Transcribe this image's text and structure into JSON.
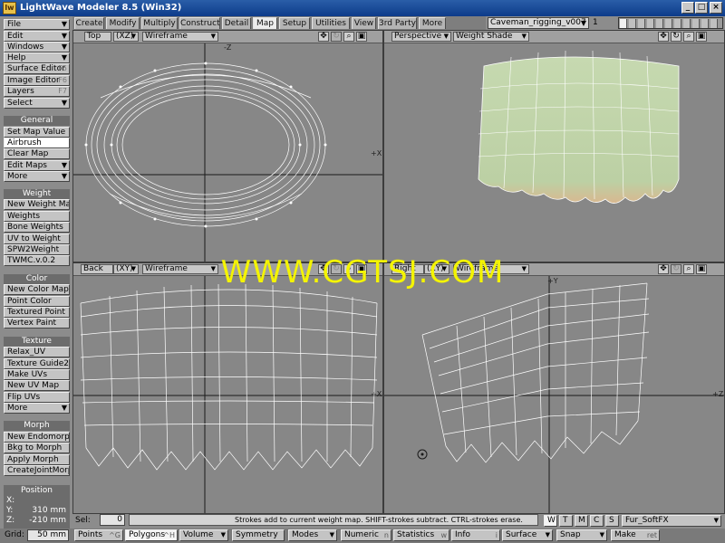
{
  "window": {
    "title": "LightWave Modeler 8.5 (Win32)",
    "app_icon": "lw",
    "min_label": "_",
    "max_label": "□",
    "close_label": "×"
  },
  "tabs": [
    "Create",
    "Modify",
    "Multiply",
    "Construct",
    "Detail",
    "Map",
    "Setup",
    "Utilities",
    "View",
    "3rd Party",
    "More"
  ],
  "active_tab": "Map",
  "scene": {
    "name": "Caveman_rigging_v007",
    "layer": "1"
  },
  "menu": {
    "file": "File",
    "edit": "Edit",
    "windows": "Windows",
    "help": "Help",
    "surface_editor": "Surface Editor",
    "surface_editor_key": "F5",
    "image_editor": "Image Editor",
    "image_editor_key": "F6",
    "layers": "Layers",
    "layers_key": "F7",
    "select": "Select"
  },
  "groups": {
    "general": {
      "title": "General",
      "items": [
        "Set Map Value",
        "Airbrush",
        "Clear Map",
        "Edit Maps",
        "More"
      ]
    },
    "weight": {
      "title": "Weight",
      "items": [
        "New Weight Map",
        "Weights",
        "Bone Weights",
        "UV to Weight",
        "SPW2Weight",
        "TWMC.v.0.2"
      ]
    },
    "color": {
      "title": "Color",
      "items": [
        "New Color Map",
        "Point Color",
        "Textured Point",
        "Vertex Paint"
      ]
    },
    "texture": {
      "title": "Texture",
      "items": [
        "Relax_UV",
        "Texture Guide2",
        "Make UVs",
        "New UV Map",
        "Flip UVs",
        "More"
      ]
    },
    "morph": {
      "title": "Morph",
      "items": [
        "New Endomorph",
        "Bkg to Morph",
        "Apply Morph",
        "CreateJointMorph"
      ]
    }
  },
  "position": {
    "title": "Position",
    "x_label": "X:",
    "x": "",
    "y_label": "Y:",
    "y": "310 mm",
    "z_label": "Z:",
    "z": "-210 mm"
  },
  "viewports": {
    "top": {
      "view": "Top",
      "axis": "(XZ)",
      "mode": "Wireframe"
    },
    "perspective": {
      "view": "Perspective",
      "mode": "Weight Shade"
    },
    "back": {
      "view": "Back",
      "axis": "(XY)",
      "mode": "Wireframe"
    },
    "right": {
      "view": "Right",
      "axis": "(ZY)",
      "mode": "Wireframe"
    }
  },
  "axis_labels": {
    "z": "-Z",
    "x": "+X",
    "y": "+Y",
    "xr": "+X",
    "zr": "+Z"
  },
  "watermark": "WWW.CGTSJ.COM",
  "status": {
    "sel_label": "Sel:",
    "sel_value": "0",
    "message": "Strokes add to current weight map. SHIFT-strokes subtract. CTRL-strokes erase.",
    "map_letters": [
      "W",
      "T",
      "M",
      "C",
      "S"
    ],
    "active_map_letter": "W",
    "map_name": "Fur_SoftFX"
  },
  "bottom": {
    "grid_label": "Grid:",
    "grid_value": "50 mm",
    "points": "Points",
    "points_key": "^G",
    "polygons": "Polygons",
    "polygons_key": "^H",
    "volume": "Volume",
    "symmetry": "Symmetry",
    "modes": "Modes",
    "numeric": "Numeric",
    "numeric_key": "n",
    "statistics": "Statistics",
    "statistics_key": "w",
    "info": "Info",
    "info_key": "i",
    "surface": "Surface",
    "snap": "Snap",
    "make": "Make",
    "make_key": "ret"
  },
  "colors": {
    "title_bar": "#0d3b8a",
    "viewport_bg": "#878787",
    "wire": "#ffffff",
    "mesh_shade": "#c4d6b0",
    "watermark": "#f4f400"
  }
}
